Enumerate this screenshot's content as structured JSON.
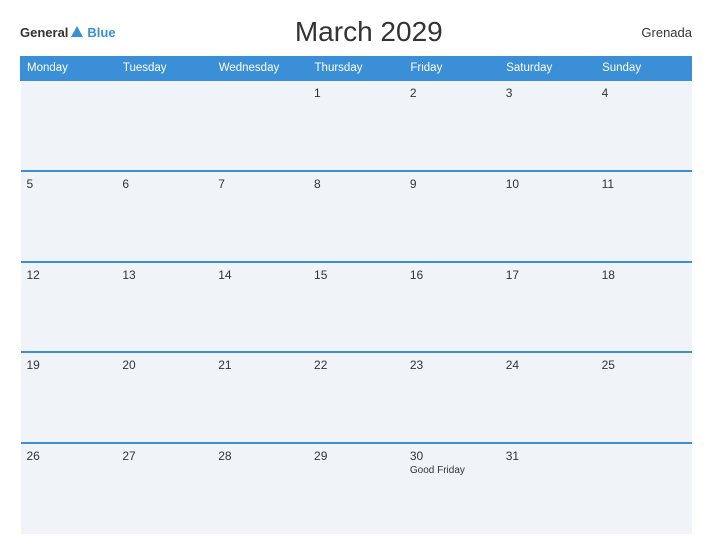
{
  "logo": {
    "general": "General",
    "blue": "Blue"
  },
  "header": {
    "title": "March 2029",
    "country": "Grenada"
  },
  "days_of_week": [
    "Monday",
    "Tuesday",
    "Wednesday",
    "Thursday",
    "Friday",
    "Saturday",
    "Sunday"
  ],
  "weeks": [
    [
      {
        "day": "",
        "event": ""
      },
      {
        "day": "",
        "event": ""
      },
      {
        "day": "",
        "event": ""
      },
      {
        "day": "1",
        "event": ""
      },
      {
        "day": "2",
        "event": ""
      },
      {
        "day": "3",
        "event": ""
      },
      {
        "day": "4",
        "event": ""
      }
    ],
    [
      {
        "day": "5",
        "event": ""
      },
      {
        "day": "6",
        "event": ""
      },
      {
        "day": "7",
        "event": ""
      },
      {
        "day": "8",
        "event": ""
      },
      {
        "day": "9",
        "event": ""
      },
      {
        "day": "10",
        "event": ""
      },
      {
        "day": "11",
        "event": ""
      }
    ],
    [
      {
        "day": "12",
        "event": ""
      },
      {
        "day": "13",
        "event": ""
      },
      {
        "day": "14",
        "event": ""
      },
      {
        "day": "15",
        "event": ""
      },
      {
        "day": "16",
        "event": ""
      },
      {
        "day": "17",
        "event": ""
      },
      {
        "day": "18",
        "event": ""
      }
    ],
    [
      {
        "day": "19",
        "event": ""
      },
      {
        "day": "20",
        "event": ""
      },
      {
        "day": "21",
        "event": ""
      },
      {
        "day": "22",
        "event": ""
      },
      {
        "day": "23",
        "event": ""
      },
      {
        "day": "24",
        "event": ""
      },
      {
        "day": "25",
        "event": ""
      }
    ],
    [
      {
        "day": "26",
        "event": ""
      },
      {
        "day": "27",
        "event": ""
      },
      {
        "day": "28",
        "event": ""
      },
      {
        "day": "29",
        "event": ""
      },
      {
        "day": "30",
        "event": "Good Friday"
      },
      {
        "day": "31",
        "event": ""
      },
      {
        "day": "",
        "event": ""
      }
    ]
  ]
}
